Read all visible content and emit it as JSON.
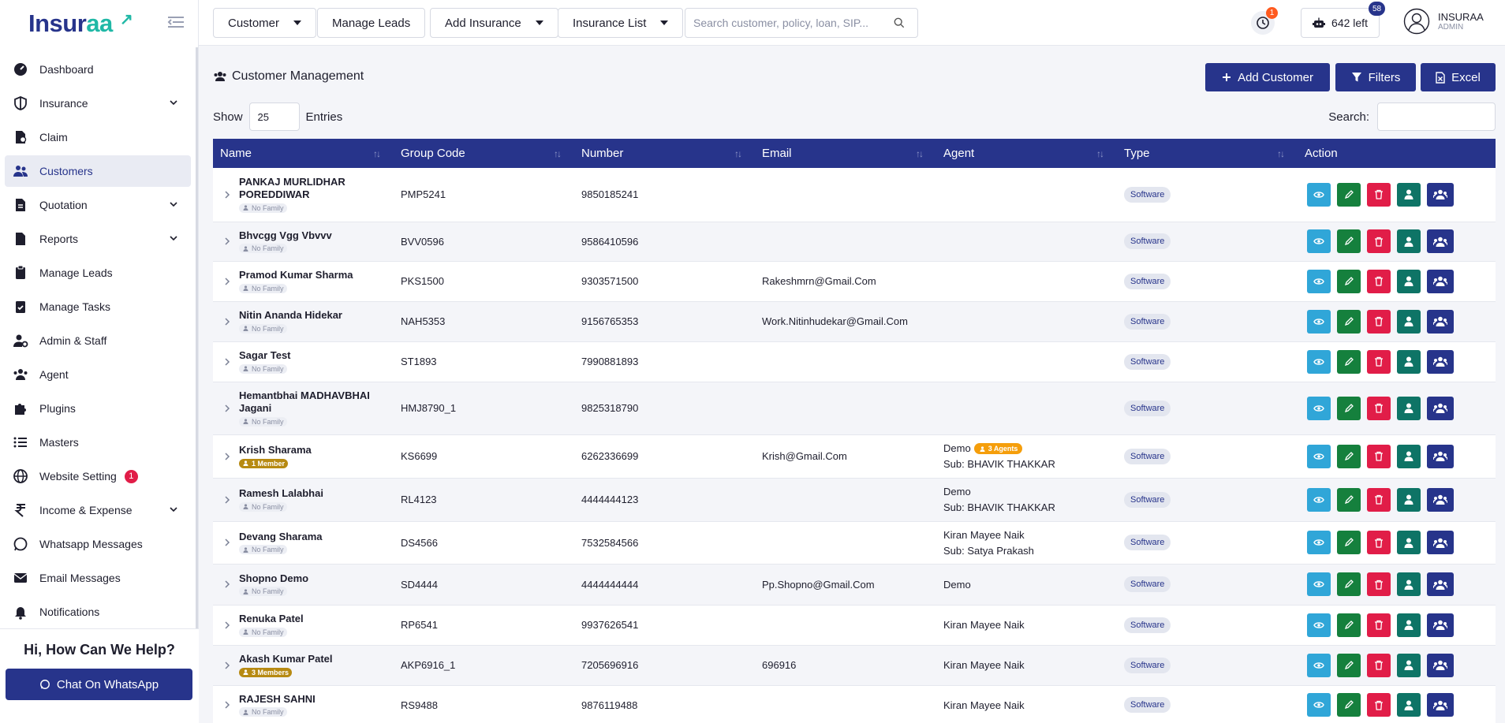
{
  "brand": {
    "logo_main": "Insur",
    "logo_accent": "aa"
  },
  "sidebar": {
    "items": [
      {
        "label": "Dashboard",
        "icon": "dashboard-icon",
        "expandable": false
      },
      {
        "label": "Insurance",
        "icon": "shield-icon",
        "expandable": true
      },
      {
        "label": "Claim",
        "icon": "claim-file-icon",
        "expandable": false
      },
      {
        "label": "Customers",
        "icon": "users-icon",
        "expandable": false,
        "active": true
      },
      {
        "label": "Quotation",
        "icon": "quotation-icon",
        "expandable": true
      },
      {
        "label": "Reports",
        "icon": "report-icon",
        "expandable": true
      },
      {
        "label": "Manage Leads",
        "icon": "clipboard-icon",
        "expandable": false
      },
      {
        "label": "Manage Tasks",
        "icon": "task-check-icon",
        "expandable": false
      },
      {
        "label": "Admin & Staff",
        "icon": "user-gear-icon",
        "expandable": false
      },
      {
        "label": "Agent",
        "icon": "agent-group-icon",
        "expandable": false
      },
      {
        "label": "Plugins",
        "icon": "puzzle-icon",
        "expandable": false
      },
      {
        "label": "Masters",
        "icon": "list-icon",
        "expandable": false
      },
      {
        "label": "Website Setting",
        "icon": "globe-icon",
        "expandable": false,
        "badge": "1"
      },
      {
        "label": "Income & Expense",
        "icon": "rupee-icon",
        "expandable": true
      },
      {
        "label": "Whatsapp Messages",
        "icon": "whatsapp-icon",
        "expandable": false
      },
      {
        "label": "Email Messages",
        "icon": "envelope-icon",
        "expandable": false
      },
      {
        "label": "Notifications",
        "icon": "bell-icon",
        "expandable": false
      }
    ],
    "help_title": "Hi, How Can We Help?",
    "whatsapp_button": "Chat On WhatsApp"
  },
  "topbar": {
    "customer_menu": "Customer",
    "manage_leads": "Manage Leads",
    "add_insurance": "Add Insurance",
    "insurance_list": "Insurance List",
    "search_placeholder": "Search customer, policy, loan, SIP...",
    "clock_badge": "1",
    "credits_label": "642 left",
    "credits_badge": "58",
    "user_name": "INSURAA",
    "user_role": "ADMIN"
  },
  "page": {
    "title": "Customer Management",
    "add_customer": "Add Customer",
    "filters": "Filters",
    "excel": "Excel",
    "show_label": "Show",
    "entries_value": "25",
    "entries_label": "Entries",
    "search_label": "Search:"
  },
  "table": {
    "headers": [
      "Name",
      "Group Code",
      "Number",
      "Email",
      "Agent",
      "Type",
      "Action"
    ],
    "rows": [
      {
        "name": "PANKAJ MURLIDHAR\nPOREDDIWAR",
        "family": "No Family",
        "family_type": "none",
        "group": "PMP5241",
        "number": "9850185241",
        "email": "",
        "agent": "",
        "agent_tag": "",
        "agent_sub": "",
        "type": "Software"
      },
      {
        "name": "Bhvcgg Vgg Vbvvv",
        "family": "No Family",
        "family_type": "none",
        "group": "BVV0596",
        "number": "9586410596",
        "email": "",
        "agent": "",
        "agent_tag": "",
        "agent_sub": "",
        "type": "Software"
      },
      {
        "name": "Pramod Kumar Sharma",
        "family": "No Family",
        "family_type": "none",
        "group": "PKS1500",
        "number": "9303571500",
        "email": "Rakeshmrn@Gmail.Com",
        "agent": "",
        "agent_tag": "",
        "agent_sub": "",
        "type": "Software"
      },
      {
        "name": "Nitin Ananda Hidekar",
        "family": "No Family",
        "family_type": "none",
        "group": "NAH5353",
        "number": "9156765353",
        "email": "Work.Nitinhudekar@Gmail.Com",
        "agent": "",
        "agent_tag": "",
        "agent_sub": "",
        "type": "Software"
      },
      {
        "name": "Sagar Test",
        "family": "No Family",
        "family_type": "none",
        "group": "ST1893",
        "number": "7990881893",
        "email": "",
        "agent": "",
        "agent_tag": "",
        "agent_sub": "",
        "type": "Software"
      },
      {
        "name": "Hemantbhai MADHAVBHAI\nJagani",
        "family": "No Family",
        "family_type": "none",
        "group": "HMJ8790_1",
        "number": "9825318790",
        "email": "",
        "agent": "",
        "agent_tag": "",
        "agent_sub": "",
        "type": "Software"
      },
      {
        "name": "Krish Sharama",
        "family": "1 Member",
        "family_type": "member",
        "group": "KS6699",
        "number": "6262336699",
        "email": "Krish@Gmail.Com",
        "agent": "Demo",
        "agent_tag": "3 Agents",
        "agent_sub": "Sub: BHAVIK THAKKAR",
        "type": "Software"
      },
      {
        "name": "Ramesh Lalabhai",
        "family": "No Family",
        "family_type": "none",
        "group": "RL4123",
        "number": "4444444123",
        "email": "",
        "agent": "Demo",
        "agent_tag": "",
        "agent_sub": "Sub: BHAVIK THAKKAR",
        "type": "Software"
      },
      {
        "name": "Devang Sharama",
        "family": "No Family",
        "family_type": "none",
        "group": "DS4566",
        "number": "7532584566",
        "email": "",
        "agent": "Kiran Mayee Naik",
        "agent_tag": "",
        "agent_sub": "Sub: Satya Prakash",
        "type": "Software"
      },
      {
        "name": "Shopno Demo",
        "family": "No Family",
        "family_type": "none",
        "group": "SD4444",
        "number": "4444444444",
        "email": "Pp.Shopno@Gmail.Com",
        "agent": "Demo",
        "agent_tag": "",
        "agent_sub": "",
        "type": "Software"
      },
      {
        "name": "Renuka Patel",
        "family": "No Family",
        "family_type": "none",
        "group": "RP6541",
        "number": "9937626541",
        "email": "",
        "agent": "Kiran Mayee Naik",
        "agent_tag": "",
        "agent_sub": "",
        "type": "Software"
      },
      {
        "name": "Akash Kumar Patel",
        "family": "3 Members",
        "family_type": "member",
        "group": "AKP6916_1",
        "number": "7205696916",
        "email": "696916",
        "agent": "Kiran Mayee Naik",
        "agent_tag": "",
        "agent_sub": "",
        "type": "Software"
      },
      {
        "name": "RAJESH SAHNI",
        "family": "No Family",
        "family_type": "none",
        "group": "RS9488",
        "number": "9876119488",
        "email": "",
        "agent": "Kiran Mayee Naik",
        "agent_tag": "",
        "agent_sub": "",
        "type": "Software"
      }
    ]
  },
  "colors": {
    "primary": "#27348b",
    "accent": "#20b8a6",
    "view": "#30a6d8",
    "edit": "#15803d",
    "delete": "#e11d48",
    "user": "#0e7466"
  }
}
